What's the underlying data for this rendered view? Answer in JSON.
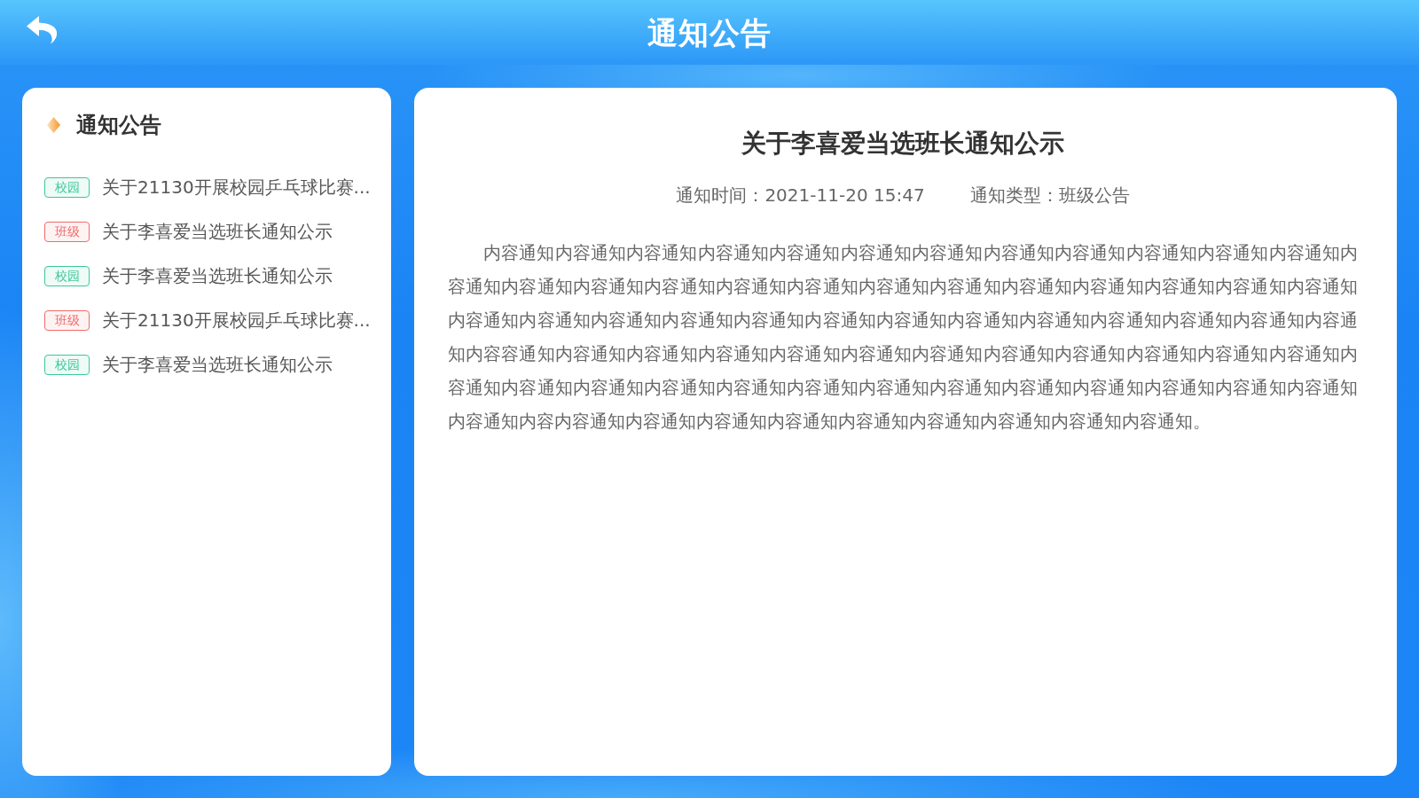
{
  "header": {
    "title": "通知公告"
  },
  "sidebar": {
    "title": "通知公告",
    "items": [
      {
        "tag": {
          "label": "校园",
          "color": "#3cc79a"
        },
        "title": "关于21130开展校园乒乓球比赛..."
      },
      {
        "tag": {
          "label": "班级",
          "color": "#f06b6b"
        },
        "title": "关于李喜爱当选班长通知公示"
      },
      {
        "tag": {
          "label": "校园",
          "color": "#3cc79a"
        },
        "title": "关于李喜爱当选班长通知公示"
      },
      {
        "tag": {
          "label": "班级",
          "color": "#f06b6b"
        },
        "title": "关于21130开展校园乒乓球比赛..."
      },
      {
        "tag": {
          "label": "校园",
          "color": "#3cc79a"
        },
        "title": "关于李喜爱当选班长通知公示"
      }
    ]
  },
  "notice": {
    "title": "关于李喜爱当选班长通知公示",
    "meta": [
      {
        "label": "通知时间：",
        "value": "2021-11-20 15:47"
      },
      {
        "label": "通知类型：",
        "value": "班级公告"
      }
    ],
    "body": "内容通知内容通知内容通知内容通知内容通知内容通知内容通知内容通知内容通知内容通知内容通知内容通知内容通知内容通知内容通知内容通知内容通知内容通知内容通知内容通知内容通知内容通知内容通知内容通知内容通知内容通知内容通知内容通知内容通知内容通知内容通知内容通知内容通知内容通知内容通知内容通知内容通知内容通知内容容通知内容通知内容通知内容通知内容通知内容通知内容通知内容通知内容通知内容通知内容通知内容通知内容通知内容通知内容通知内容通知内容通知内容通知内容通知内容通知内容通知内容通知内容通知内容通知内容通知内容通知内容内容通知内容通知内容通知内容通知内容通知内容通知内容通知内容通知内容通知。"
  }
}
